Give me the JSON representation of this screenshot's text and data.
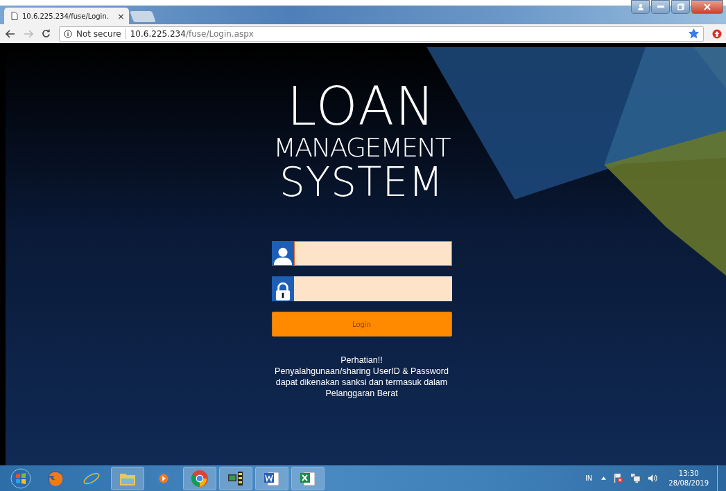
{
  "browser": {
    "tab": {
      "title": "10.6.225.234/fuse/Login.",
      "close": "×"
    },
    "security": "Not secure",
    "url_host": "10.6.225.234",
    "url_path": "/fuse/Login.aspx",
    "bookmarked": true
  },
  "page": {
    "title_lines": [
      "LOAN",
      "MANAGEMENT",
      "SYSTEM"
    ],
    "fields": [
      {
        "kind": "user",
        "focused": true
      },
      {
        "kind": "password",
        "focused": false
      }
    ],
    "login_button": "Login",
    "notice": [
      "Perhatian!!",
      "Penyalahgunaan/sharing UserID & Password",
      "dapat dikenakan sanksi dan termasuk dalam",
      "Pelanggaran Berat"
    ]
  },
  "taskbar": {
    "apps": [
      {
        "kind": "firefox",
        "running": false
      },
      {
        "kind": "ie",
        "running": false
      },
      {
        "kind": "folder",
        "running": true
      },
      {
        "kind": "media",
        "running": false
      },
      {
        "kind": "chrome",
        "running": true
      },
      {
        "kind": "monitor",
        "running": true
      },
      {
        "kind": "word",
        "running": true
      },
      {
        "kind": "excel",
        "running": true
      }
    ],
    "language": "IN",
    "time": "13:30",
    "date": "28/08/2019"
  }
}
